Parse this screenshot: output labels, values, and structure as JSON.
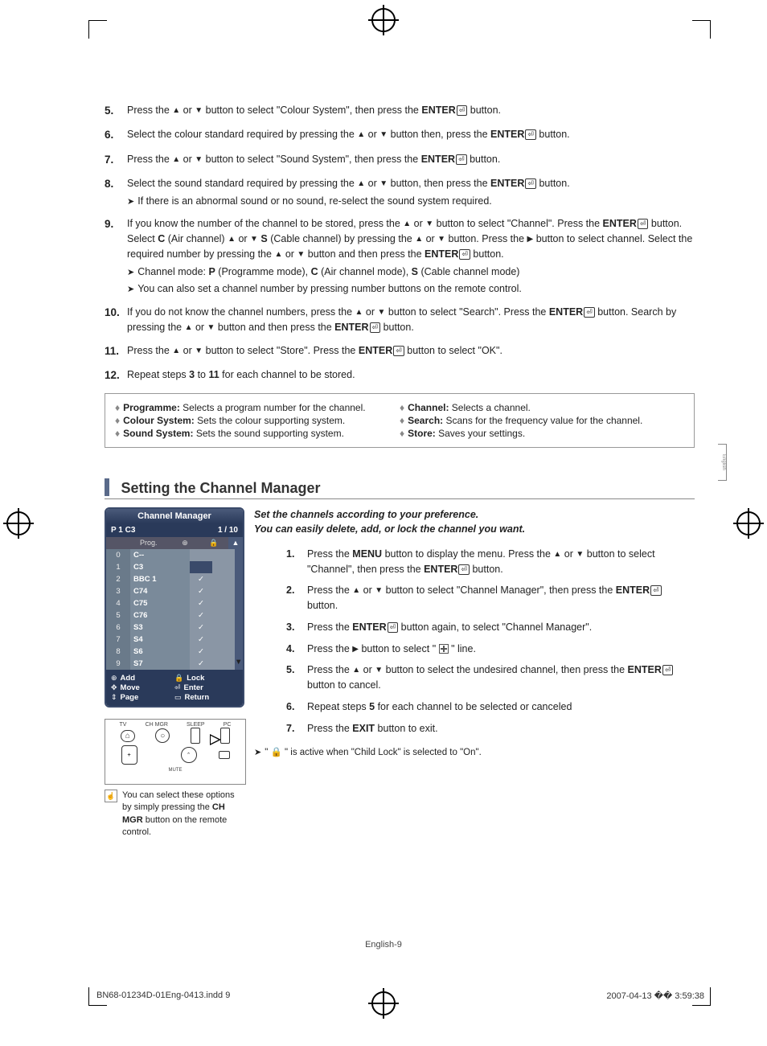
{
  "steps": [
    {
      "n": "5.",
      "parts": [
        "Press the ",
        " or ",
        " button to select \"Colour System\", then press the ",
        "ENTER",
        " button."
      ]
    },
    {
      "n": "6.",
      "parts": [
        "Select the colour standard required by pressing the ",
        " or ",
        " button then, press the ",
        "ENTER",
        " button."
      ]
    },
    {
      "n": "7.",
      "parts": [
        "Press the ",
        " or ",
        " button to select \"Sound System\", then press the ",
        "ENTER",
        " button."
      ]
    },
    {
      "n": "8.",
      "parts": [
        "Select the sound standard required by pressing the ",
        " or ",
        " button, then press the ",
        "ENTER",
        " button."
      ],
      "notes": [
        "If there is an abnormal sound or no sound, re-select the sound system required."
      ]
    },
    {
      "n": "9.",
      "parts": [
        "If you know the number of the channel to be stored, press the ",
        " or ",
        " button to select \"Channel\". Press the ",
        "ENTER",
        " button. Select ",
        "C",
        " (Air channel) or ",
        "S",
        " (Cable channel) by pressing the ",
        " or ",
        " button. Press the ",
        " button to select channel. Select the required number by pressing the ",
        " or ",
        " button and then press the ",
        "ENTER",
        " button."
      ],
      "notes": [
        "Channel mode: P (Programme mode), C (Air channel mode), S (Cable channel mode)",
        "You can also set a channel number by pressing number buttons on the remote control."
      ],
      "boldidx": [
        5,
        7
      ]
    },
    {
      "n": "10.",
      "parts": [
        "If you do not know the channel numbers, press the ",
        " or ",
        " button to select \"Search\". Press the ",
        "ENTER",
        " button. Search by pressing the ",
        " or ",
        " button and then press the ",
        "ENTER",
        " button."
      ]
    },
    {
      "n": "11.",
      "parts": [
        "Press the ",
        " or ",
        " button to select \"Store\". Press the ",
        "ENTER",
        " button to select \"OK\"."
      ]
    },
    {
      "n": "12.",
      "plain": "Repeat steps 3 to 11 for each channel to be stored.",
      "boldrange": [
        "3",
        "11"
      ]
    }
  ],
  "infobox": {
    "left": [
      {
        "term": "Programme:",
        "desc": "Selects a program number for the channel."
      },
      {
        "term": "Colour System:",
        "desc": "Sets the colour supporting system."
      },
      {
        "term": "Sound System:",
        "desc": "Sets the sound supporting system."
      }
    ],
    "right": [
      {
        "term": "Channel:",
        "desc": "Selects a channel."
      },
      {
        "term": "Search:",
        "desc": "Scans for the frequency value for the channel."
      },
      {
        "term": "Store:",
        "desc": "Saves your settings."
      }
    ]
  },
  "section_title": "Setting the Channel Manager",
  "osd": {
    "title": "Channel Manager",
    "sub_left": "P 1   C3",
    "sub_right": "1 / 10",
    "header": {
      "prog": "Prog.",
      "add": "⊕",
      "lock": "🔒"
    },
    "rows": [
      {
        "n": "0",
        "name": "C--",
        "tick": false
      },
      {
        "n": "1",
        "name": "C3",
        "tick": false,
        "hl": true
      },
      {
        "n": "2",
        "name": "BBC 1",
        "tick": true
      },
      {
        "n": "3",
        "name": "C74",
        "tick": true
      },
      {
        "n": "4",
        "name": "C75",
        "tick": true
      },
      {
        "n": "5",
        "name": "C76",
        "tick": true
      },
      {
        "n": "6",
        "name": "S3",
        "tick": true
      },
      {
        "n": "7",
        "name": "S4",
        "tick": true
      },
      {
        "n": "8",
        "name": "S6",
        "tick": true
      },
      {
        "n": "9",
        "name": "S7",
        "tick": true
      }
    ],
    "legend": [
      [
        {
          "ic": "⊕",
          "t": "Add"
        },
        {
          "ic": "🔒",
          "t": "Lock"
        }
      ],
      [
        {
          "ic": "✥",
          "t": "Move"
        },
        {
          "ic": "⏎",
          "t": "Enter"
        }
      ],
      [
        {
          "ic": "⇕",
          "t": "Page"
        },
        {
          "ic": "▭",
          "t": "Return"
        }
      ]
    ]
  },
  "remote": {
    "top": [
      "TV",
      "CH MGR",
      "SLEEP",
      "PC"
    ],
    "mute": "MUTE"
  },
  "caption_text": "You can select these options  by simply pressing the  CH MGR button on the remote control.",
  "caption_bold": "CH MGR",
  "intro": [
    "Set the channels according to your preference.",
    "You can easily delete, add, or lock the channel you want."
  ],
  "substeps": [
    {
      "n": "1.",
      "text": "Press the MENU button to display the menu.  Press the ▲ or ▼ button to select \"Channel\", then press the ENTER button.",
      "bold": [
        "MENU",
        "ENTER"
      ]
    },
    {
      "n": "2.",
      "text": "Press the ▲ or ▼ button to select \"Channel Manager\", then press the ENTER button.",
      "bold": [
        "ENTER"
      ]
    },
    {
      "n": "3.",
      "text": "Press the ENTER button again, to select \"Channel Manager\".",
      "bold": [
        "ENTER"
      ]
    },
    {
      "n": "4.",
      "text": "Press the ▶ button to select \" ⊞ \" line."
    },
    {
      "n": "5.",
      "text": "Press the ▲ or ▼ button to select the undesired channel, then press the ENTER button to cancel.",
      "bold": [
        "ENTER"
      ]
    },
    {
      "n": "6.",
      "text": "Repeat steps 5 for each channel to be selected or canceled",
      "bold": [
        "5"
      ]
    },
    {
      "n": "7.",
      "text": "Press the EXIT button to exit.",
      "bold": [
        "EXIT"
      ]
    }
  ],
  "footnote": "\" 🔒 \" is active when \"Child Lock\" is selected to \"On\".",
  "page_footer": "English-9",
  "meta_left": "BN68-01234D-01Eng-0413.indd   9",
  "meta_right": "2007-04-13   �� 3:59:38",
  "side_tab": "English"
}
